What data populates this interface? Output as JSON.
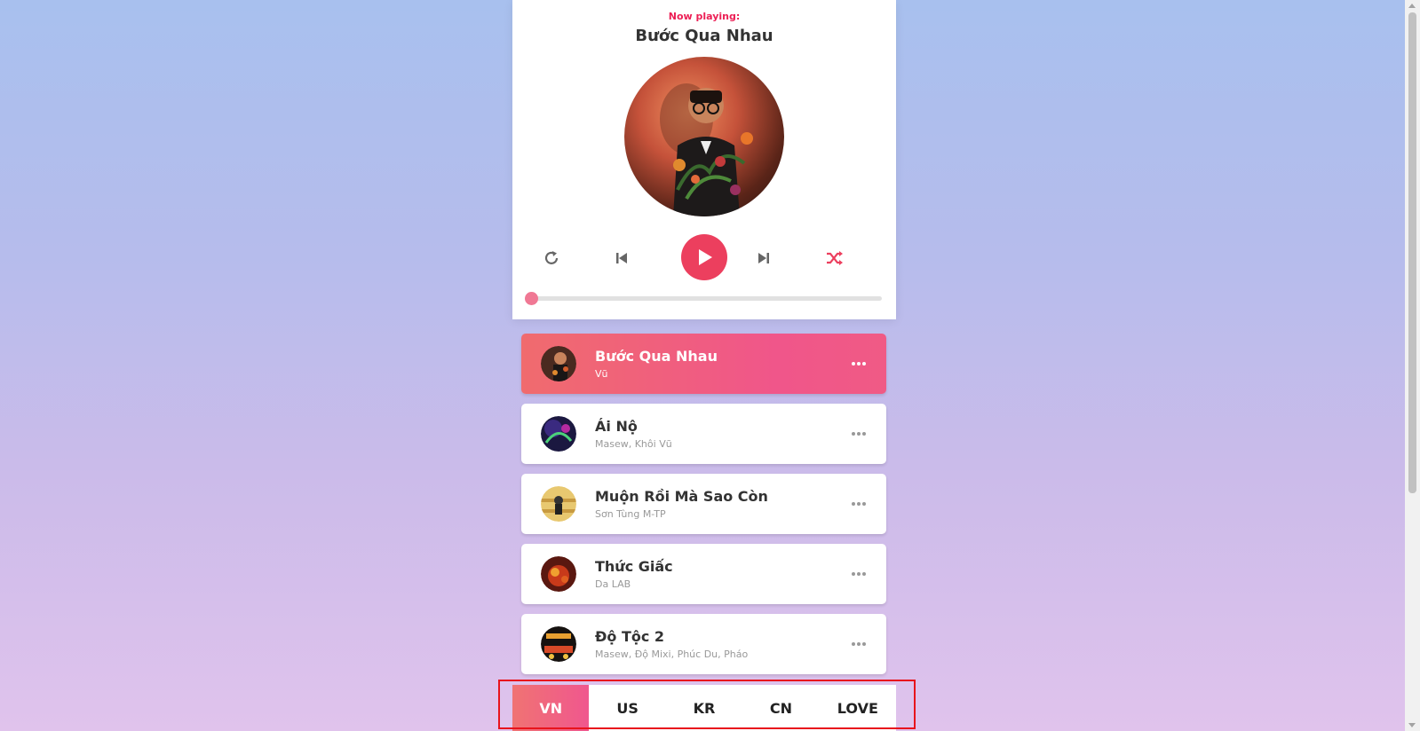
{
  "dashboard": {
    "now_playing_label": "Now playing:",
    "current_title": "Bước Qua Nhau",
    "progress": 0
  },
  "controls": {
    "repeat_icon": "repeat-icon",
    "prev_icon": "step-backward-icon",
    "play_icon": "play-icon",
    "next_icon": "step-forward-icon",
    "random_icon": "shuffle-icon",
    "accent": "#ec3f5e"
  },
  "playlist": [
    {
      "title": "Bước Qua Nhau",
      "author": "Vũ",
      "active": true
    },
    {
      "title": "Ái Nộ",
      "author": "Masew, Khôi Vũ",
      "active": false
    },
    {
      "title": "Muộn Rồi Mà Sao Còn",
      "author": "Sơn Tùng M-TP",
      "active": false
    },
    {
      "title": "Thức Giấc",
      "author": "Da LAB",
      "active": false
    },
    {
      "title": "Độ Tộc 2",
      "author": "Masew, Độ Mixi, Phúc Du, Pháo",
      "active": false
    }
  ],
  "tabs": [
    {
      "label": "VN",
      "active": true
    },
    {
      "label": "US",
      "active": false
    },
    {
      "label": "KR",
      "active": false
    },
    {
      "label": "CN",
      "active": false
    },
    {
      "label": "LOVE",
      "active": false
    }
  ]
}
